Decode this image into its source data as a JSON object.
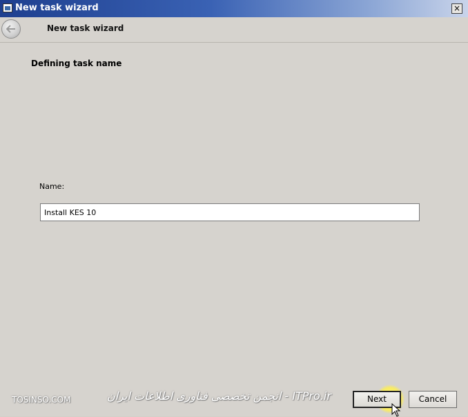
{
  "window": {
    "title": "New task wizard",
    "close_glyph": "×"
  },
  "header": {
    "title": "New task wizard",
    "back_icon": "back-arrow-icon"
  },
  "content": {
    "section_heading": "Defining task name",
    "name_label": "Name:",
    "name_value": "Install KES 10"
  },
  "footer": {
    "watermark_left": "TOSINSO.COM",
    "watermark_right": "ITPro.ir - انجمن تخصصی فناوری اطلاعات ایران",
    "next_label": "Next",
    "cancel_label": "Cancel"
  },
  "colors": {
    "titlebar_start": "#1e3f8f",
    "window_bg": "#d6d3ce",
    "cursor_highlight": "#fff050"
  }
}
